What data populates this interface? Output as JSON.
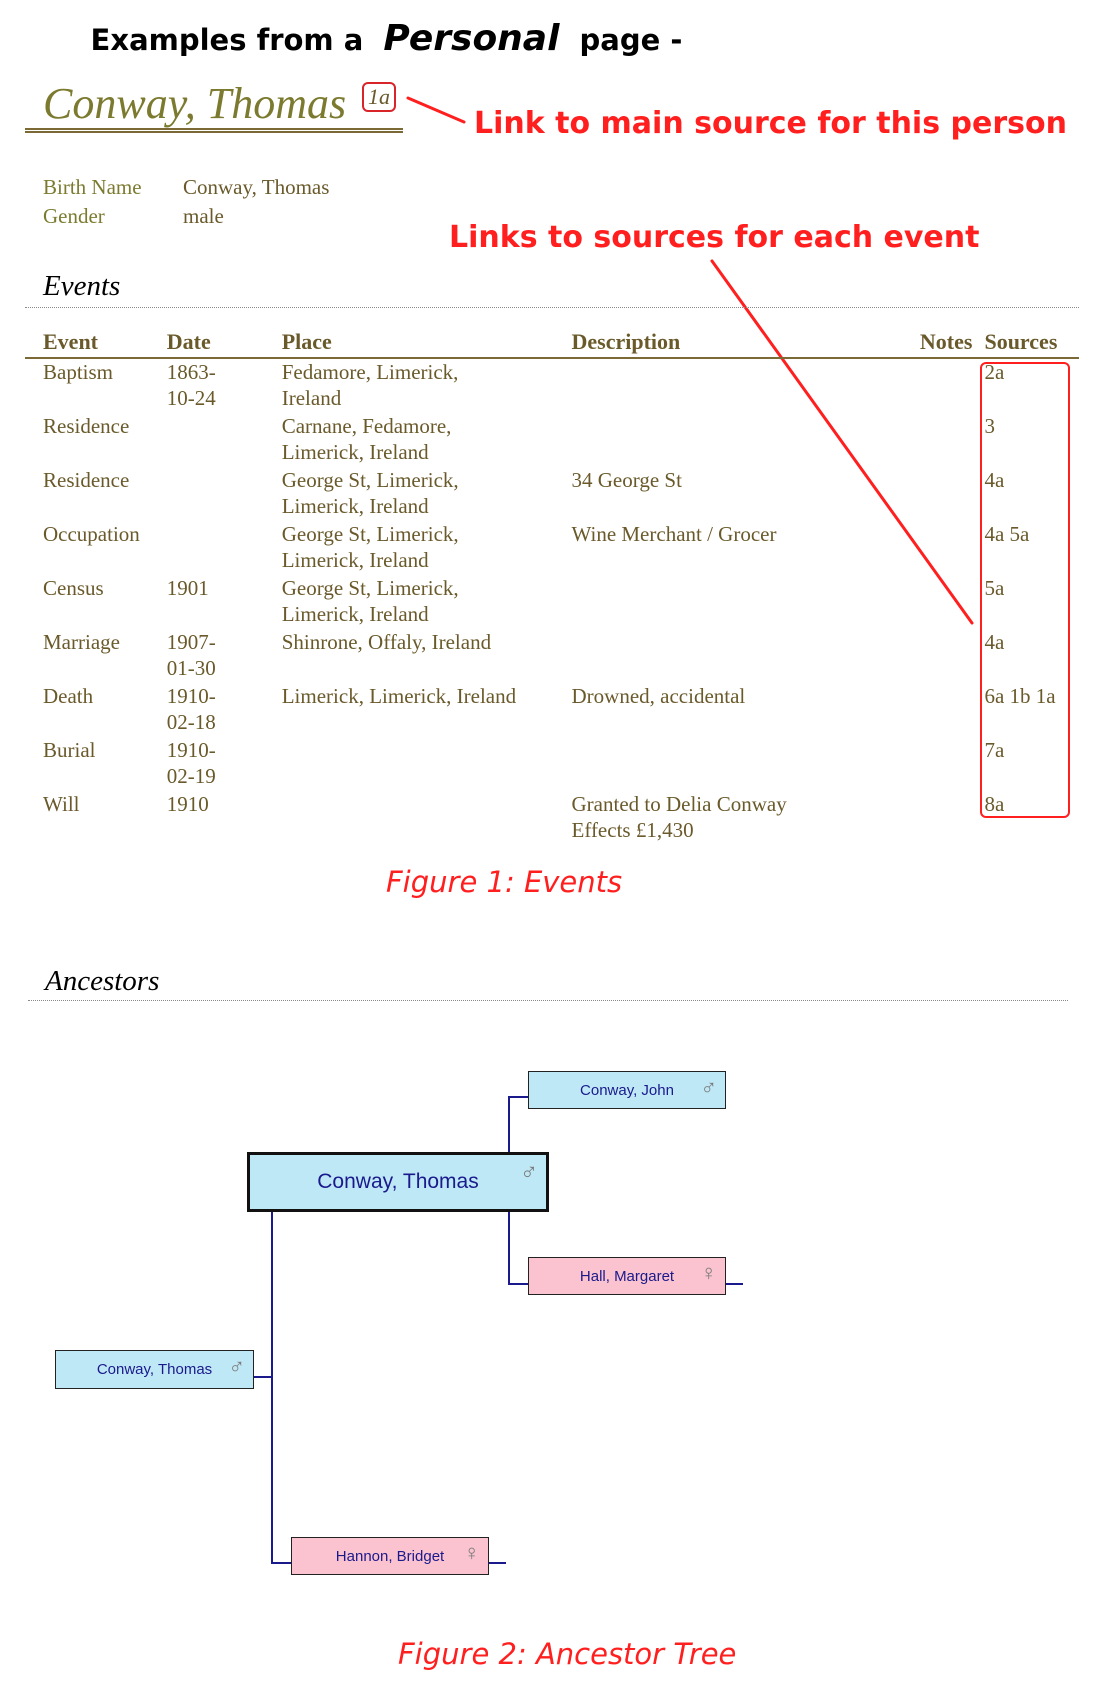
{
  "heading": {
    "prefix": "Examples from a",
    "emphasis": "Personal",
    "suffix": "page -"
  },
  "person": {
    "name": "Conway, Thomas",
    "source_ref": "1a"
  },
  "annotations": {
    "main_source": "Link to main source for this person",
    "event_sources": "Links to sources for each event"
  },
  "attributes": [
    {
      "label": "Birth Name",
      "value": "Conway, Thomas"
    },
    {
      "label": "Gender",
      "value": "male"
    }
  ],
  "events_section": {
    "title": "Events",
    "columns": [
      "Event",
      "Date",
      "Place",
      "Description",
      "Notes",
      "Sources"
    ],
    "rows": [
      {
        "event": "Baptism",
        "date": "1863-\n10-24",
        "place": "Fedamore, Limerick,\nIreland",
        "description": "",
        "notes": "",
        "sources": "2a"
      },
      {
        "event": "Residence",
        "date": "",
        "place": "Carnane, Fedamore,\nLimerick, Ireland",
        "description": "",
        "notes": "",
        "sources": "3"
      },
      {
        "event": "Residence",
        "date": "",
        "place": "George St, Limerick,\nLimerick, Ireland",
        "description": "34 George St",
        "notes": "",
        "sources": "4a"
      },
      {
        "event": "Occupation",
        "date": "",
        "place": "George St, Limerick,\nLimerick, Ireland",
        "description": "Wine Merchant / Grocer",
        "notes": "",
        "sources": "4a 5a"
      },
      {
        "event": "Census",
        "date": "1901",
        "place": "George St, Limerick,\nLimerick, Ireland",
        "description": "",
        "notes": "",
        "sources": "5a"
      },
      {
        "event": "Marriage",
        "date": "1907-\n01-30",
        "place": "Shinrone, Offaly, Ireland",
        "description": "",
        "notes": "",
        "sources": "4a"
      },
      {
        "event": "Death",
        "date": "1910-\n02-18",
        "place": "Limerick, Limerick, Ireland",
        "description": "Drowned, accidental",
        "notes": "",
        "sources": "6a 1b 1a"
      },
      {
        "event": "Burial",
        "date": "1910-\n02-19",
        "place": "",
        "description": "",
        "notes": "",
        "sources": "7a"
      },
      {
        "event": "Will",
        "date": "1910",
        "place": "",
        "description": "Granted to Delia Conway\nEffects £1,430",
        "notes": "",
        "sources": "8a"
      }
    ]
  },
  "figure1_caption": "Figure 1: Events",
  "ancestors_section": {
    "title": "Ancestors",
    "tree": {
      "center": {
        "name": "Conway, Thomas",
        "gender": "male",
        "icon": "male-symbol-icon"
      },
      "father": {
        "name": "Conway, John",
        "gender": "male",
        "icon": "male-symbol-icon"
      },
      "mother": {
        "name": "Hall, Margaret",
        "gender": "female",
        "icon": "female-symbol-icon"
      },
      "child_male": {
        "name": "Conway, Thomas",
        "gender": "male",
        "icon": "male-symbol-icon"
      },
      "child_female": {
        "name": "Hannon, Bridget",
        "gender": "female",
        "icon": "female-symbol-icon"
      }
    }
  },
  "figure2_caption": "Figure 2: Ancestor Tree",
  "colors": {
    "annotation_red": "#ff1f1f",
    "name_olive": "#7b7a2f",
    "text_brown": "#6a5a2b",
    "male_box": "#bfe8f7",
    "female_box": "#fac3cf",
    "tree_line": "#1a1a8c"
  }
}
